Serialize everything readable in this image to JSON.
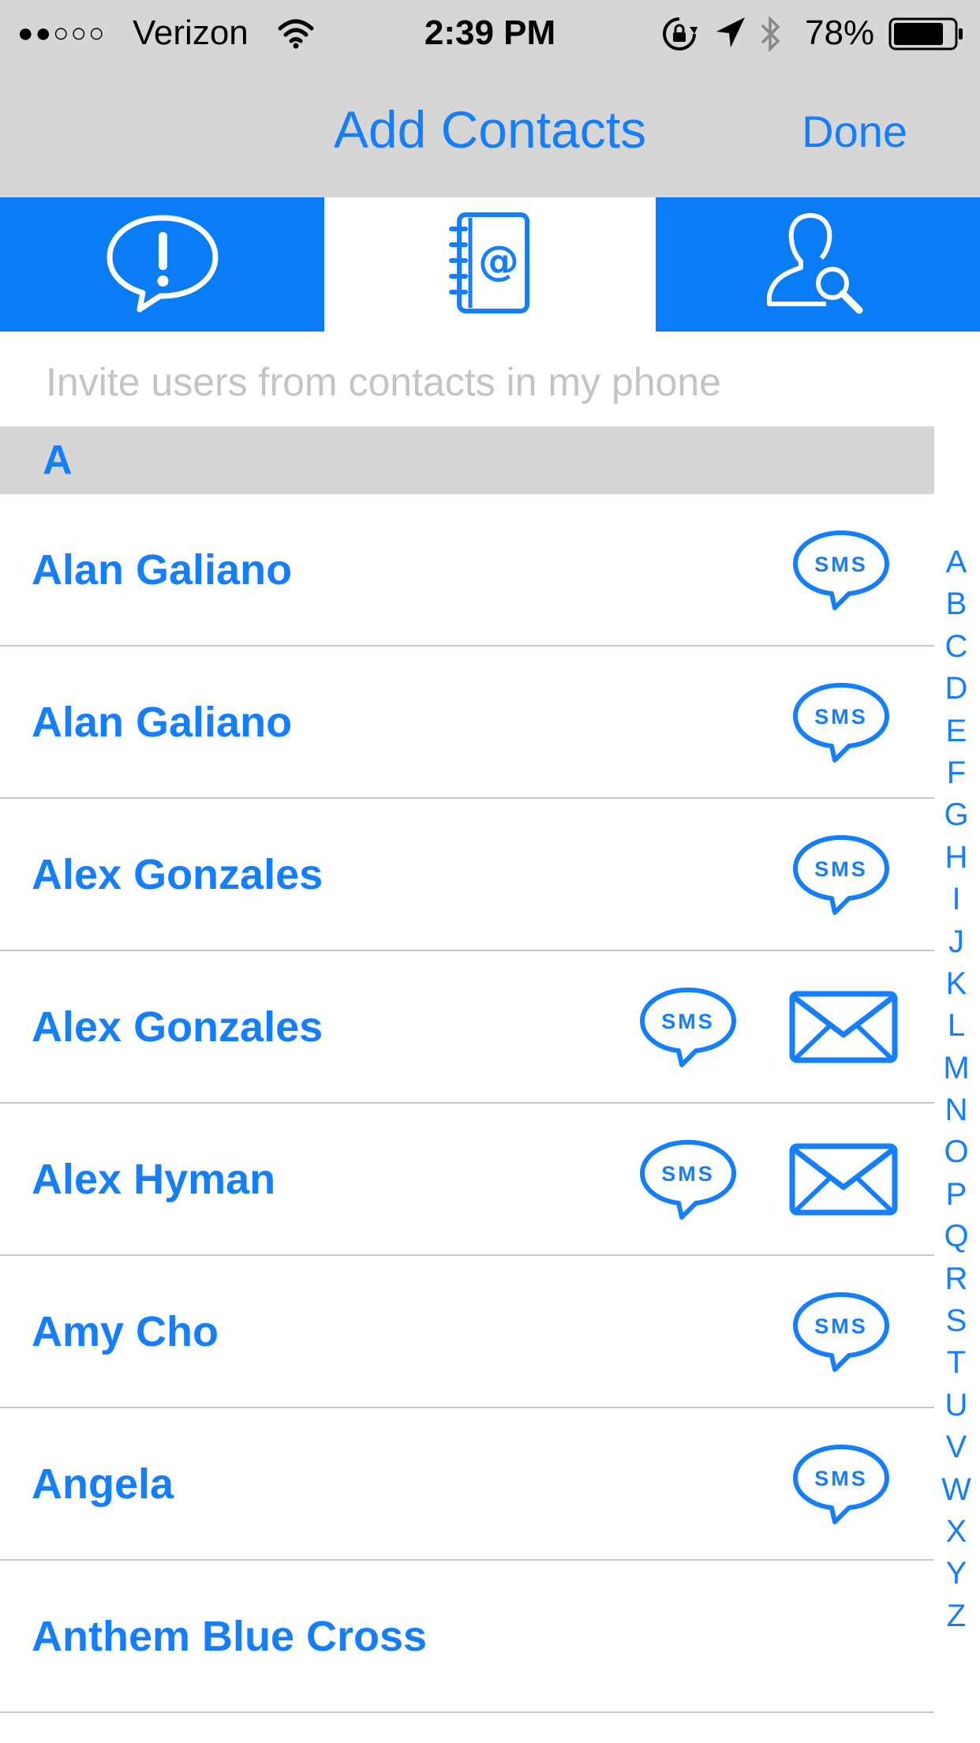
{
  "status_bar": {
    "signal": "●●○○○",
    "carrier": "Verizon",
    "time": "2:39 PM",
    "battery": "78%",
    "icons": [
      "wifi-icon",
      "rotation-lock-icon",
      "location-arrow-icon",
      "bluetooth-icon",
      "battery-icon"
    ]
  },
  "nav": {
    "title": "Add Contacts",
    "done_label": "Done"
  },
  "tabs": [
    {
      "icon": "alert-bubble-icon",
      "selected": false
    },
    {
      "icon": "address-book-icon",
      "selected": true
    },
    {
      "icon": "user-search-icon",
      "selected": false
    }
  ],
  "hint": "Invite users from contacts in my phone",
  "section": {
    "letter": "A"
  },
  "contacts": [
    {
      "name": "Alan Galiano",
      "sms": true,
      "email": false
    },
    {
      "name": "Alan Galiano",
      "sms": true,
      "email": false
    },
    {
      "name": "Alex Gonzales",
      "sms": true,
      "email": false
    },
    {
      "name": "Alex Gonzales",
      "sms": true,
      "email": true
    },
    {
      "name": "Alex Hyman",
      "sms": true,
      "email": true
    },
    {
      "name": "Amy Cho",
      "sms": true,
      "email": false
    },
    {
      "name": "Angela",
      "sms": true,
      "email": false
    },
    {
      "name": "Anthem Blue Cross",
      "sms": false,
      "email": false
    }
  ],
  "sms_label": "SMS",
  "index_letters": [
    "A",
    "B",
    "C",
    "D",
    "E",
    "F",
    "G",
    "H",
    "I",
    "J",
    "K",
    "L",
    "M",
    "N",
    "O",
    "P",
    "Q",
    "R",
    "S",
    "T",
    "U",
    "V",
    "W",
    "X",
    "Y",
    "Z"
  ],
  "colors": {
    "accent": "#157efb",
    "tab_active_bg": "#0a7cf5",
    "bar_bg": "#d6d6d6",
    "hint": "#c4c4c4"
  }
}
